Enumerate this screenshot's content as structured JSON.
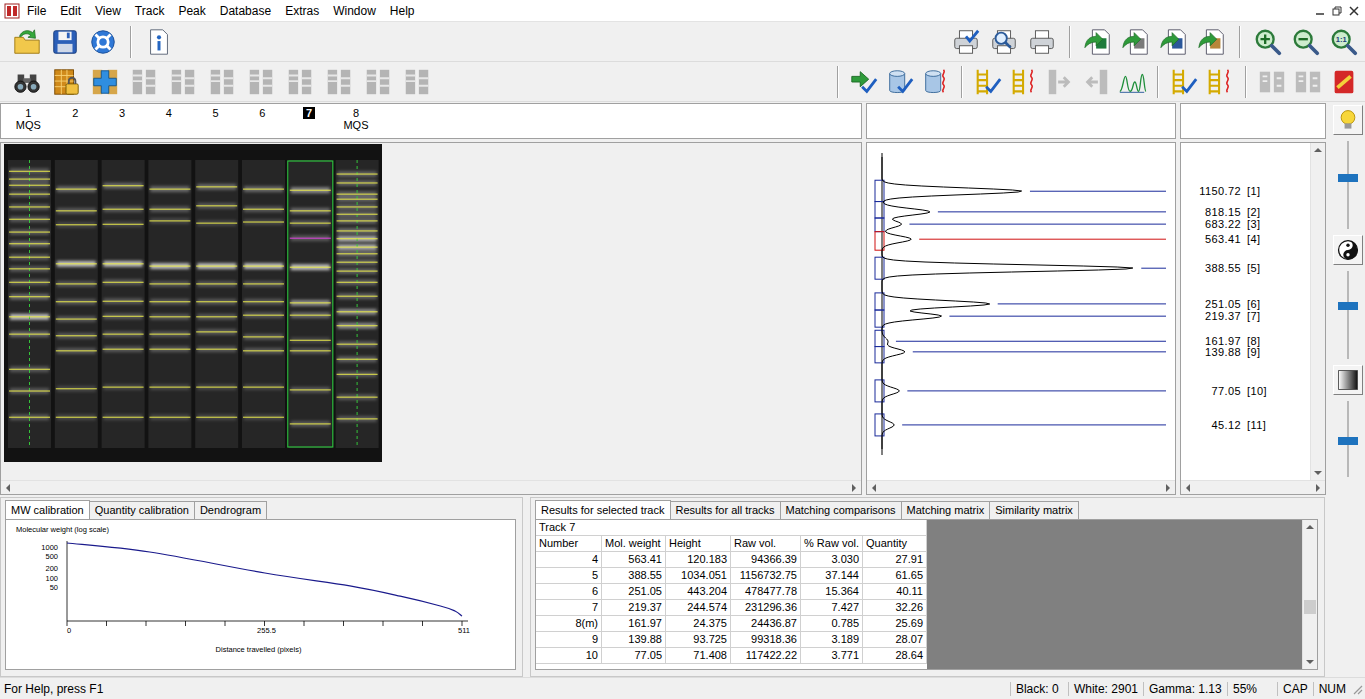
{
  "menu": {
    "items": [
      "File",
      "Edit",
      "View",
      "Track",
      "Peak",
      "Database",
      "Extras",
      "Window",
      "Help"
    ]
  },
  "toolbar_top": {
    "left": [
      {
        "kind": "open",
        "disabled": false
      },
      {
        "kind": "save",
        "disabled": false
      },
      {
        "kind": "help",
        "disabled": false
      },
      {
        "kind": "separator",
        "disabled": false
      },
      {
        "kind": "info",
        "disabled": false
      }
    ],
    "right": [
      {
        "kind": "setup",
        "disabled": false
      },
      {
        "kind": "preview",
        "disabled": false
      },
      {
        "kind": "print",
        "disabled": false
      },
      {
        "kind": "separator",
        "disabled": false
      },
      {
        "kind": "excel",
        "disabled": false
      },
      {
        "kind": "text",
        "disabled": false
      },
      {
        "kind": "word",
        "disabled": false
      },
      {
        "kind": "clipboard",
        "disabled": false
      },
      {
        "kind": "separator",
        "disabled": false
      },
      {
        "kind": "zoomin",
        "disabled": false
      },
      {
        "kind": "zoomout",
        "disabled": false
      },
      {
        "kind": "zoomfit",
        "disabled": false,
        "label": "1:1"
      }
    ]
  },
  "toolbar_lanes": {
    "left": [
      {
        "kind": "find",
        "disabled": false
      },
      {
        "kind": "lock",
        "disabled": false
      },
      {
        "kind": "addlane",
        "disabled": false
      },
      {
        "kind": "lane",
        "disabled": true
      },
      {
        "kind": "lane",
        "disabled": true
      },
      {
        "kind": "lane",
        "disabled": true
      },
      {
        "kind": "lane",
        "disabled": true
      },
      {
        "kind": "lane",
        "disabled": true
      },
      {
        "kind": "lane",
        "disabled": true
      },
      {
        "kind": "lane",
        "disabled": true
      },
      {
        "kind": "lane",
        "disabled": true
      }
    ],
    "right": [
      {
        "kind": "separator",
        "disabled": false
      },
      {
        "kind": "apply",
        "disabled": false
      },
      {
        "kind": "dbcheck",
        "disabled": false
      },
      {
        "kind": "db",
        "disabled": false
      },
      {
        "kind": "separator",
        "disabled": false
      },
      {
        "kind": "laddercheck",
        "disabled": false
      },
      {
        "kind": "ladder",
        "disabled": false
      },
      {
        "kind": "merge",
        "disabled": true
      },
      {
        "kind": "split",
        "disabled": true
      },
      {
        "kind": "peaks",
        "disabled": false
      },
      {
        "kind": "separator",
        "disabled": false
      },
      {
        "kind": "laddercheck",
        "disabled": false
      },
      {
        "kind": "ladder",
        "disabled": false
      },
      {
        "kind": "separator",
        "disabled": false
      },
      {
        "kind": "match",
        "disabled": true
      },
      {
        "kind": "match",
        "disabled": true
      },
      {
        "kind": "ytool",
        "disabled": false
      }
    ]
  },
  "lanes": [
    {
      "number": "1",
      "label": "MQS",
      "selected": false,
      "reference": true,
      "bands": [
        22,
        36,
        47,
        63,
        86,
        108,
        131,
        152,
        176,
        197,
        221,
        247,
        283,
        314,
        377,
        416,
        463
      ],
      "intensity": [
        0.3,
        0.3,
        0.3,
        0.3,
        0.3,
        0.3,
        0.3,
        0.4,
        0.3,
        0.3,
        0.3,
        0.4,
        0.9,
        0.4,
        0.3,
        0.3,
        0.3
      ]
    },
    {
      "number": "2",
      "label": "",
      "selected": false,
      "reference": false,
      "bands": [
        54,
        93,
        118,
        188,
        224,
        256,
        287,
        317,
        344,
        412,
        463
      ],
      "intensity": [
        0.4,
        0.3,
        0.2,
        0.9,
        0.3,
        0.3,
        0.3,
        0.3,
        0.3,
        0.2,
        0.2
      ]
    },
    {
      "number": "3",
      "label": "",
      "selected": false,
      "reference": false,
      "bands": [
        48,
        90,
        117,
        188,
        221,
        255,
        282,
        314,
        341,
        409,
        463
      ],
      "intensity": [
        0.4,
        0.3,
        0.2,
        0.9,
        0.3,
        0.3,
        0.3,
        0.3,
        0.3,
        0.2,
        0.2
      ]
    },
    {
      "number": "4",
      "label": "",
      "selected": false,
      "reference": false,
      "bands": [
        54,
        90,
        111,
        192,
        224,
        256,
        283,
        314,
        341,
        409,
        463
      ],
      "intensity": [
        0.4,
        0.3,
        0.2,
        0.9,
        0.3,
        0.3,
        0.3,
        0.3,
        0.3,
        0.2,
        0.2
      ]
    },
    {
      "number": "5",
      "label": "",
      "selected": false,
      "reference": false,
      "bands": [
        50,
        84,
        115,
        192,
        224,
        256,
        283,
        310,
        341,
        409,
        463
      ],
      "intensity": [
        0.4,
        0.3,
        0.2,
        0.9,
        0.3,
        0.3,
        0.3,
        0.3,
        0.3,
        0.2,
        0.2
      ]
    },
    {
      "number": "6",
      "label": "",
      "selected": false,
      "reference": false,
      "bands": [
        54,
        90,
        113,
        192,
        224,
        256,
        280,
        319,
        344,
        409,
        463
      ],
      "intensity": [
        0.4,
        0.3,
        0.2,
        0.9,
        0.3,
        0.3,
        0.3,
        0.3,
        0.3,
        0.2,
        0.2
      ]
    },
    {
      "number": "7",
      "label": "",
      "selected": true,
      "reference": false,
      "bands": [
        56,
        93,
        115,
        142,
        194,
        258,
        280,
        325,
        344,
        414,
        475
      ],
      "intensity": [
        0.6,
        0.4,
        0.3,
        0.3,
        0.9,
        0.6,
        0.4,
        0.2,
        0.3,
        0.3,
        0.3
      ]
    },
    {
      "number": "8",
      "label": "MQS",
      "selected": false,
      "reference": true,
      "bands": [
        27,
        43,
        63,
        72,
        86,
        99,
        111,
        129,
        143,
        158,
        170,
        185,
        201,
        221,
        246,
        274,
        299,
        332,
        359,
        386,
        427,
        466
      ],
      "intensity": [
        0.35,
        0.35,
        0.35,
        0.35,
        0.35,
        0.35,
        0.35,
        0.4,
        0.8,
        0.8,
        0.4,
        0.35,
        0.35,
        0.35,
        0.35,
        0.6,
        0.6,
        0.35,
        0.35,
        0.3,
        0.3,
        0.3
      ]
    }
  ],
  "profile": {
    "peaks": [
      {
        "mw": "1150.72",
        "tag": "[1]",
        "distance": 56,
        "height": 576,
        "selected": false
      },
      {
        "mw": "818.15",
        "tag": "[2]",
        "distance": 93,
        "height": 197,
        "selected": false
      },
      {
        "mw": "683.22",
        "tag": "[3]",
        "distance": 115,
        "height": 80,
        "selected": false
      },
      {
        "mw": "563.41",
        "tag": "[4]",
        "distance": 142,
        "height": 120.183,
        "selected": true
      },
      {
        "mw": "388.55",
        "tag": "[5]",
        "distance": 194,
        "height": 1034.051,
        "selected": false
      },
      {
        "mw": "251.05",
        "tag": "[6]",
        "distance": 258,
        "height": 443.204,
        "selected": false
      },
      {
        "mw": "219.37",
        "tag": "[7]",
        "distance": 280,
        "height": 244.574,
        "selected": false
      },
      {
        "mw": "161.97",
        "tag": "[8]",
        "distance": 325,
        "height": 24.375,
        "selected": false
      },
      {
        "mw": "139.88",
        "tag": "[9]",
        "distance": 344,
        "height": 93.725,
        "selected": false
      },
      {
        "mw": "77.05",
        "tag": "[10]",
        "distance": 414,
        "height": 71.408,
        "selected": false
      },
      {
        "mw": "45.12",
        "tag": "[11]",
        "distance": 475,
        "height": 50,
        "selected": false
      }
    ]
  },
  "side_strip": [
    {
      "kind": "bulb"
    },
    {
      "kind": "slider",
      "level": 0.59
    },
    {
      "kind": "contrast"
    },
    {
      "kind": "slider",
      "level": 0.61
    },
    {
      "kind": "gradient"
    },
    {
      "kind": "slider",
      "level": 0.47
    }
  ],
  "mw_calibration": {
    "tabs": [
      {
        "label": "MW calibration",
        "selected": true
      },
      {
        "label": "Quantity calibration",
        "selected": false
      },
      {
        "label": "Dendrogram",
        "selected": false
      }
    ],
    "y_title": "Molecular weight (log scale)",
    "y_ticks": [
      "1000",
      "500",
      "200",
      "100",
      "50"
    ],
    "x_ticks": [
      "0",
      "255.5",
      "511"
    ],
    "x_title": "Distance travelled (pixels)",
    "series": {
      "distance": [
        0,
        107,
        256,
        366,
        431,
        483,
        502,
        511
      ],
      "mw": [
        1350,
        688,
        142,
        54,
        25,
        12,
        8.2,
        5.6
      ]
    }
  },
  "results": {
    "tabs": [
      {
        "label": "Results for selected track",
        "selected": true
      },
      {
        "label": "Results for all tracks",
        "selected": false
      },
      {
        "label": "Matching comparisons",
        "selected": false
      },
      {
        "label": "Matching matrix",
        "selected": false
      },
      {
        "label": "Similarity matrix",
        "selected": false
      }
    ],
    "title": "Track 7",
    "columns": [
      "Number",
      "Mol. weight",
      "Height",
      "Raw vol.",
      "% Raw vol.",
      "Quantity"
    ],
    "rows": [
      [
        "4",
        "563.41",
        "120.183",
        "94366.39",
        "3.030",
        "27.91"
      ],
      [
        "5",
        "388.55",
        "1034.051",
        "1156732.75",
        "37.144",
        "61.65"
      ],
      [
        "6",
        "251.05",
        "443.204",
        "478477.78",
        "15.364",
        "40.11"
      ],
      [
        "7",
        "219.37",
        "244.574",
        "231296.36",
        "7.427",
        "32.26"
      ],
      [
        "8(m)",
        "161.97",
        "24.375",
        "24436.87",
        "0.785",
        "25.69"
      ],
      [
        "9",
        "139.88",
        "93.725",
        "99318.36",
        "3.189",
        "28.07"
      ],
      [
        "10",
        "77.05",
        "71.408",
        "117422.22",
        "3.771",
        "28.64"
      ]
    ],
    "scroll": 0.62
  },
  "status_bar": {
    "help": "For Help, press F1",
    "fields": [
      "Black: 0",
      "White: 2901",
      "Gamma: 1.13",
      "55%",
      "CAP",
      "NUM"
    ]
  }
}
